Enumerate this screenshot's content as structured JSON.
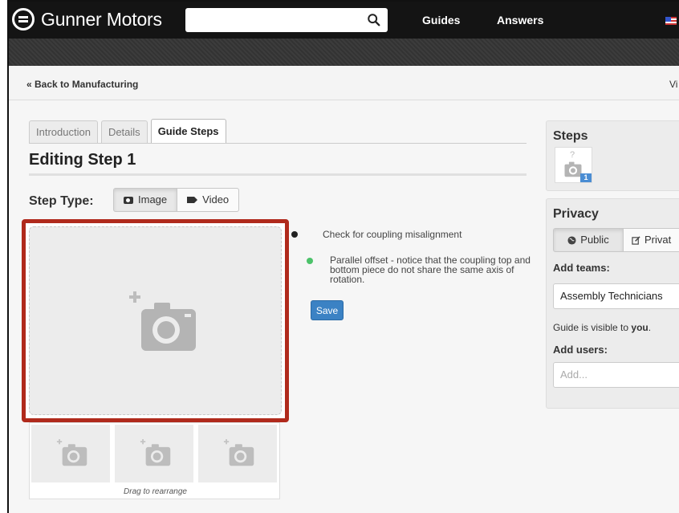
{
  "header": {
    "brand": "Gunner Motors",
    "search_placeholder": "",
    "nav": [
      "Guides",
      "Answers"
    ]
  },
  "breadcrumb": {
    "back_label": "« Back to Manufacturing",
    "right_text": "Vi"
  },
  "tabs": [
    {
      "label": "Introduction",
      "active": false
    },
    {
      "label": "Details",
      "active": false
    },
    {
      "label": "Guide Steps",
      "active": true
    }
  ],
  "editor": {
    "title": "Editing Step 1",
    "step_type_label": "Step Type:",
    "step_type_options": [
      "Image",
      "Video"
    ],
    "step_type_selected": "Image",
    "drag_note": "Drag to rearrange"
  },
  "bullets": [
    {
      "text": "Check for coupling misalignment",
      "color": "#222222"
    },
    {
      "text": "Parallel offset - notice that the coupling top and bottom piece do not share the same axis of rotation.",
      "color": "#4cc26a"
    }
  ],
  "save_label": "Save",
  "sidebar": {
    "steps_title": "Steps",
    "step_badge": "1",
    "step_placeholder": "?",
    "privacy_title": "Privacy",
    "privacy_options": [
      "Public",
      "Privat"
    ],
    "privacy_selected": "Public",
    "add_teams_label": "Add teams:",
    "team_value": "Assembly Technicians",
    "visibility_prefix": "Guide is visible to",
    "visibility_who": "you",
    "visibility_suffix": ".",
    "add_users_label": "Add users:",
    "users_placeholder": "Add..."
  },
  "colors": {
    "header_bg": "#141414",
    "highlight_border": "#b02a1c",
    "save_button": "#3b82c4",
    "step_badge": "#4a8dd3"
  },
  "icons": [
    "search-icon",
    "camera-icon",
    "video-icon",
    "globe-icon",
    "edit-icon",
    "add-photo-icon",
    "flag-icon"
  ]
}
